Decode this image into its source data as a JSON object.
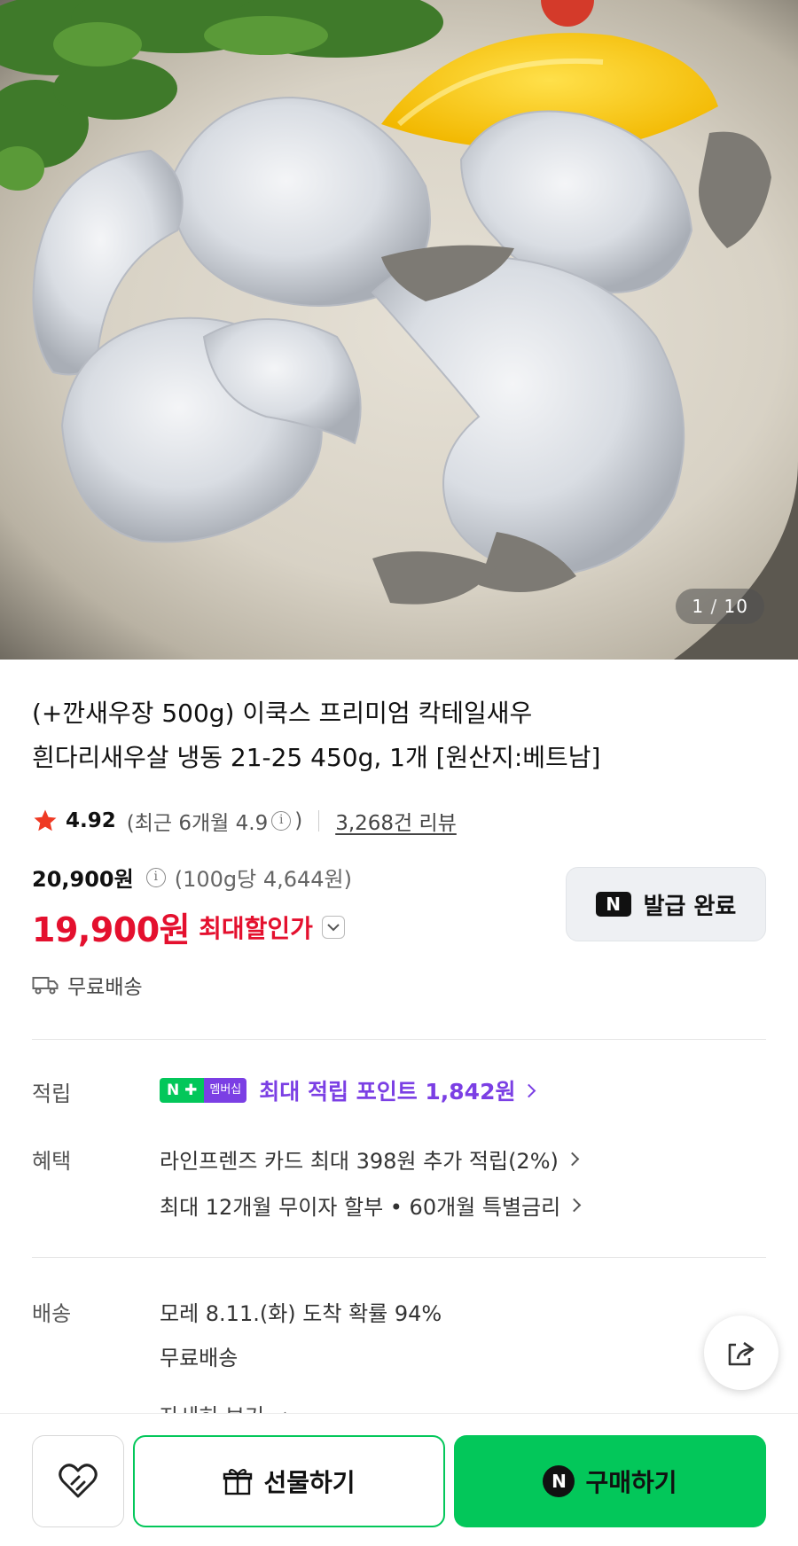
{
  "image_viewer": {
    "current": "1",
    "separator": "/",
    "total": "10"
  },
  "product": {
    "title_line1": "(+깐새우장 500g) 이쿡스 프리미엄 칵테일새우",
    "title_line2": "흰다리새우살 냉동 21-25 450g, 1개 [원산지:베트남]"
  },
  "rating": {
    "score": "4.92",
    "recent_prefix": "(최근 6개월 4.9",
    "recent_suffix": ")",
    "info_glyph": "i",
    "review_count": "3,268건 리뷰"
  },
  "price": {
    "original": "20,900원",
    "per_unit": "(100g당 4,644원)",
    "sale": "19,900원",
    "sale_label": "최대할인가"
  },
  "coupon": {
    "badge": "N",
    "label": "발급 완료"
  },
  "shipping_tag": "무료배송",
  "points": {
    "label": "적립",
    "badge_n": "N ✚",
    "badge_membership": "멤버십",
    "text": "최대 적립 포인트 1,842원"
  },
  "benefits": {
    "label": "혜택",
    "line1": "라인프렌즈 카드 최대 398원 추가 적립(2%)",
    "line2": "최대 12개월 무이자 할부 • 60개월 특별금리"
  },
  "delivery": {
    "label": "배송",
    "arrival": "모레 8.11.(화) 도착 확률 94%",
    "fee": "무료배송",
    "more": "자세히 보기"
  },
  "bottom_bar": {
    "gift_label": "선물하기",
    "buy_badge": "N",
    "buy_label": "구매하기"
  },
  "colors": {
    "sale_red": "#e4102e",
    "naver_green": "#03c75a",
    "membership_purple": "#7b3fe4"
  },
  "icons": [
    "star-icon",
    "info-icon",
    "chevron-down-icon",
    "truck-icon",
    "chevron-right-icon",
    "share-icon",
    "heart-icon",
    "gift-icon"
  ]
}
